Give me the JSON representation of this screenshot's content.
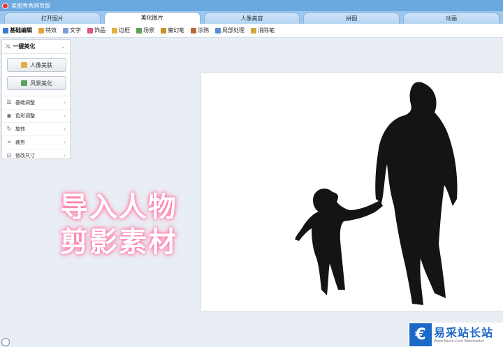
{
  "titlebar": {
    "title": "美图秀秀网页版",
    "logo_icon": "meitu-logo-icon"
  },
  "tabs": [
    {
      "label": "打开图片",
      "active": false
    },
    {
      "label": "美化图片",
      "active": true
    },
    {
      "label": "人像美容",
      "active": false
    },
    {
      "label": "拼图",
      "active": false
    },
    {
      "label": "动画",
      "active": false
    }
  ],
  "toolbar": {
    "items": [
      {
        "label": "基础编辑",
        "icon": "edit-icon",
        "color": "#3a7bd5"
      },
      {
        "label": "特效",
        "icon": "magic-wand-icon",
        "color": "#e8a33c"
      },
      {
        "label": "文字",
        "icon": "text-icon",
        "color": "#7aa0d8"
      },
      {
        "label": "饰品",
        "icon": "accessory-icon",
        "color": "#e0557a"
      },
      {
        "label": "边框",
        "icon": "frame-icon",
        "color": "#e2b23a"
      },
      {
        "label": "场景",
        "icon": "scene-icon",
        "color": "#5aa05a"
      },
      {
        "label": "魔幻笔",
        "icon": "magic-pen-icon",
        "color": "#c9932c"
      },
      {
        "label": "涂鸦",
        "icon": "brush-icon",
        "color": "#b86b3a"
      },
      {
        "label": "局部处理",
        "icon": "local-process-icon",
        "color": "#5a8fd0"
      },
      {
        "label": "消除笔",
        "icon": "eraser-icon",
        "color": "#d2a640"
      }
    ]
  },
  "panel": {
    "header": "一键美化",
    "portrait_button": "人像美肤",
    "scenery_button": "风景美化",
    "rows": [
      {
        "label": "基础调整",
        "icon": "adjust-icon"
      },
      {
        "label": "色彩调整",
        "icon": "color-icon"
      },
      {
        "label": "旋转",
        "icon": "rotate-icon"
      },
      {
        "label": "裁剪",
        "icon": "crop-icon"
      },
      {
        "label": "修改尺寸",
        "icon": "resize-icon"
      }
    ]
  },
  "overlay": {
    "line1": "导入人物",
    "line2": "剪影素材"
  },
  "watermark": {
    "name": "易采站长站",
    "url": "Www.Easck.Com  Webmaster",
    "logo_glyph": "€"
  },
  "colors": {
    "accent": "#6aa8e0",
    "silhouette": "#111111",
    "glow": "#ff6fa3"
  }
}
